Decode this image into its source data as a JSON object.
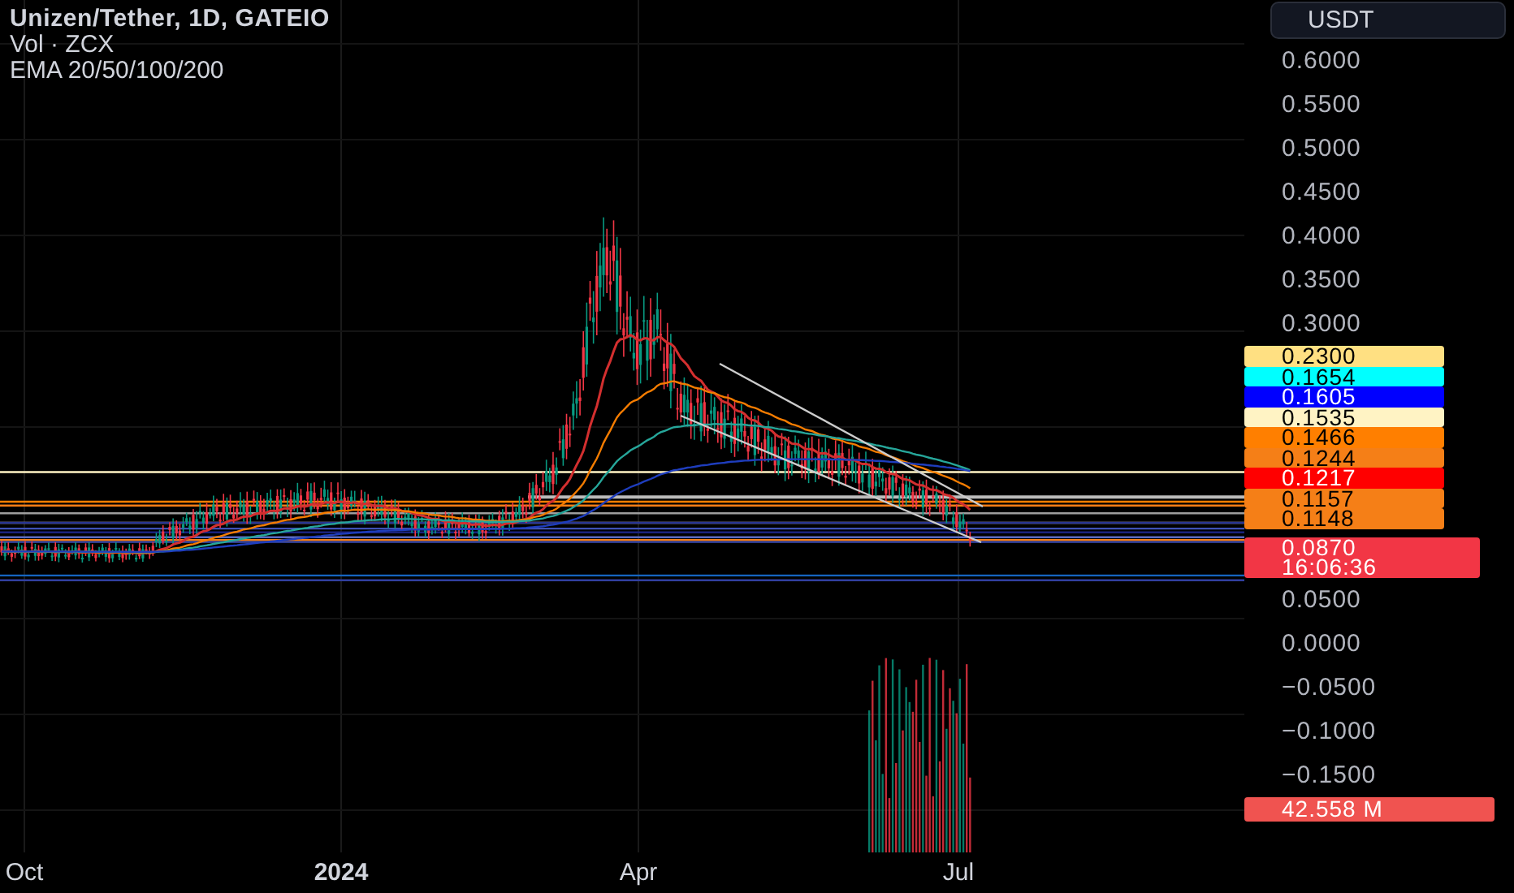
{
  "legend": {
    "title": "Unizen/Tether, 1D, GATEIO",
    "lines": [
      "Vol · ZCX",
      "EMA 20/50/100/200"
    ]
  },
  "currency_button": "USDT",
  "price_axis_upper": [
    "0.6000",
    "0.5500",
    "0.5000",
    "0.4500",
    "0.4000",
    "0.3500",
    "0.3000"
  ],
  "price_badges": [
    {
      "value": "0.2300",
      "color": "#ffe082"
    },
    {
      "value": "0.1654",
      "color": "#00ffff"
    },
    {
      "value": "0.1605",
      "color": "#0000ff"
    },
    {
      "value": "0.1535",
      "color": "#fff3c4"
    },
    {
      "value": "0.1466",
      "color": "#ff7f00"
    },
    {
      "value": "0.1244",
      "color": "#f57f17"
    },
    {
      "value": "0.1217",
      "color": "#ff0000"
    },
    {
      "value": "0.1157",
      "color": "#f57f17"
    },
    {
      "value": "0.1148",
      "color": "#f57f17"
    }
  ],
  "last_price": {
    "value": "0.0870",
    "countdown": "16:06:36"
  },
  "price_axis_lower": [
    "0.0500",
    "0.0000",
    "−0.0500",
    "−0.1000",
    "−0.1500"
  ],
  "volume_badge": "42.558 M",
  "time_axis": [
    "Oct",
    "2024",
    "Apr",
    "Jul"
  ]
}
